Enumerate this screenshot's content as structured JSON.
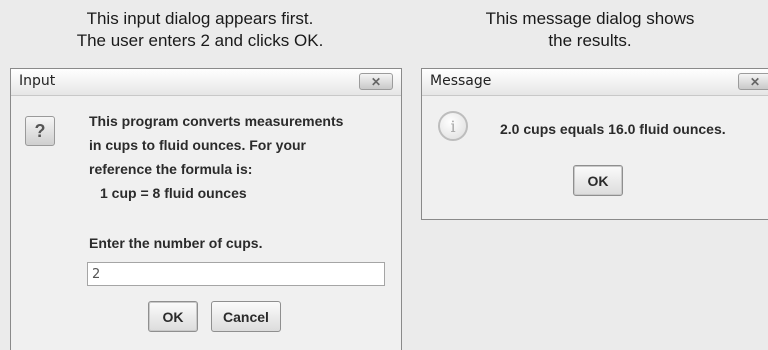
{
  "captions": {
    "left": [
      "This input dialog appears first.",
      "The user enters 2 and clicks OK."
    ],
    "right": [
      "This message dialog shows",
      "the results."
    ]
  },
  "input_dialog": {
    "title": "Input",
    "close_label": "✕",
    "icon": "question-icon",
    "icon_glyph": "?",
    "message_lines": [
      "This program converts measurements",
      "in cups to fluid ounces. For your",
      "reference the formula is:",
      "1 cup = 8 fluid ounces"
    ],
    "prompt": "Enter the number of cups.",
    "input_value": "2",
    "ok_label": "OK",
    "cancel_label": "Cancel"
  },
  "message_dialog": {
    "title": "Message",
    "close_label": "✕",
    "icon": "information-icon",
    "icon_glyph": "i",
    "message": "2.0 cups equals 16.0 fluid ounces.",
    "ok_label": "OK"
  }
}
